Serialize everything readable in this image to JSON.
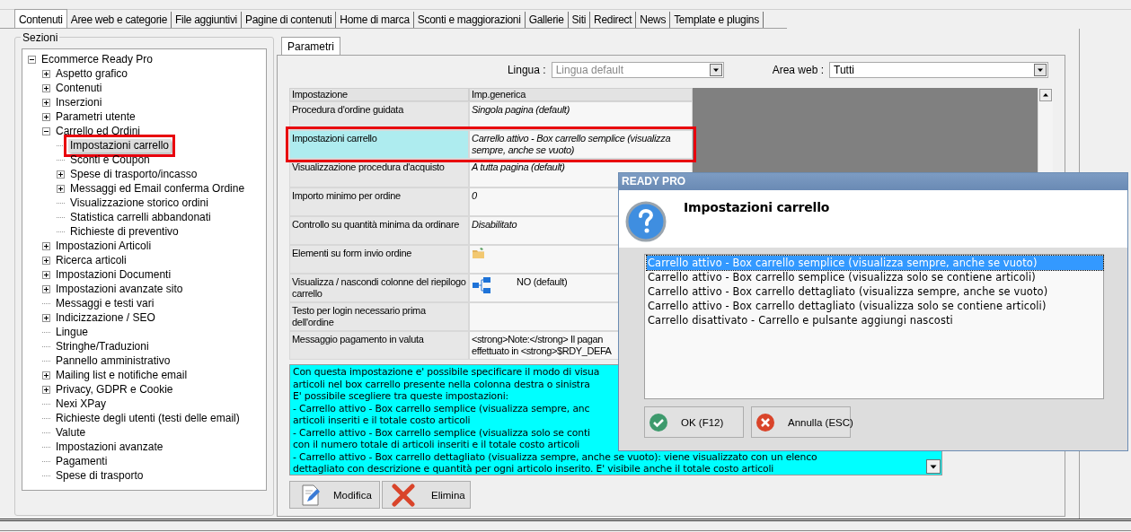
{
  "tabs": [
    {
      "label": "Contenuti",
      "selected": true
    },
    {
      "label": "Aree web e categorie",
      "selected": false
    },
    {
      "label": "File aggiuntivi",
      "selected": false
    },
    {
      "label": "Pagine di contenuti",
      "selected": false
    },
    {
      "label": "Home di marca",
      "selected": false
    },
    {
      "label": "Sconti e maggiorazioni",
      "selected": false
    },
    {
      "label": "Gallerie",
      "selected": false
    },
    {
      "label": "Siti",
      "selected": false
    },
    {
      "label": "Redirect",
      "selected": false
    },
    {
      "label": "News",
      "selected": false
    },
    {
      "label": "Template e plugins",
      "selected": false
    }
  ],
  "sections": {
    "title": "Sezioni",
    "tree": [
      {
        "label": "Ecommerce Ready Pro",
        "expanded": true,
        "selected": false,
        "highlighted": false,
        "children": [
          {
            "label": "Aspetto grafico",
            "expanded": false,
            "selected": false,
            "highlighted": false
          },
          {
            "label": "Contenuti",
            "expanded": false,
            "selected": false,
            "highlighted": false
          },
          {
            "label": "Inserzioni",
            "expanded": false,
            "selected": false,
            "highlighted": false
          },
          {
            "label": "Parametri utente",
            "expanded": false,
            "selected": false,
            "highlighted": false
          },
          {
            "label": "Carrello ed Ordini",
            "expanded": true,
            "selected": false,
            "highlighted": false,
            "children": [
              {
                "label": "Impostazioni carrello",
                "selected": true,
                "highlighted": true
              },
              {
                "label": "Sconti e Coupon",
                "selected": false,
                "highlighted": false
              },
              {
                "label": "Spese di trasporto/incasso",
                "expanded": false,
                "selected": false,
                "highlighted": false
              },
              {
                "label": "Messaggi ed Email conferma Ordine",
                "expanded": false,
                "selected": false,
                "highlighted": false
              },
              {
                "label": "Visualizzazione storico ordini",
                "selected": false,
                "highlighted": false
              },
              {
                "label": "Statistica carrelli abbandonati",
                "selected": false,
                "highlighted": false
              },
              {
                "label": "Richieste di preventivo",
                "selected": false,
                "highlighted": false
              }
            ]
          },
          {
            "label": "Impostazioni Articoli",
            "expanded": false,
            "selected": false,
            "highlighted": false
          },
          {
            "label": "Ricerca articoli",
            "expanded": false,
            "selected": false,
            "highlighted": false
          },
          {
            "label": "Impostazioni Documenti",
            "expanded": false,
            "selected": false,
            "highlighted": false
          },
          {
            "label": "Impostazioni avanzate sito",
            "expanded": false,
            "selected": false,
            "highlighted": false
          },
          {
            "label": "Messaggi e testi vari",
            "selected": false,
            "highlighted": false
          },
          {
            "label": "Indicizzazione / SEO",
            "expanded": false,
            "selected": false,
            "highlighted": false
          },
          {
            "label": "Lingue",
            "selected": false,
            "highlighted": false
          },
          {
            "label": "Stringhe/Traduzioni",
            "selected": false,
            "highlighted": false
          },
          {
            "label": "Pannello amministrativo",
            "selected": false,
            "highlighted": false
          },
          {
            "label": "Mailing list e notifiche email",
            "expanded": false,
            "selected": false,
            "highlighted": false
          },
          {
            "label": "Privacy, GDPR e Cookie",
            "expanded": false,
            "selected": false,
            "highlighted": false
          },
          {
            "label": "Nexi XPay",
            "selected": false,
            "highlighted": false
          },
          {
            "label": "Richieste degli utenti (testi delle email)",
            "selected": false,
            "highlighted": false
          },
          {
            "label": "Valute",
            "selected": false,
            "highlighted": false
          },
          {
            "label": "Impostazioni avanzate",
            "selected": false,
            "highlighted": false
          },
          {
            "label": "Pagamenti",
            "selected": false,
            "highlighted": false
          },
          {
            "label": "Spese di trasporto",
            "selected": false,
            "highlighted": false
          }
        ]
      }
    ]
  },
  "panel_tabs": [
    {
      "label": "Parametri",
      "selected": true
    }
  ],
  "filters": [
    {
      "label": "Lingua :",
      "value": "Lingua default",
      "disabled": true
    },
    {
      "label": "Area web :",
      "value": "Tutti",
      "disabled": false
    }
  ],
  "table": {
    "columns": [
      "Impostazione",
      "Imp.generica"
    ],
    "rows": [
      {
        "name": "Procedura d'ordine guidata",
        "kind": "text",
        "value": "Singola pagina (default)",
        "selected": false,
        "highlighted": false
      },
      {
        "name": "Impostazioni carrello",
        "kind": "text",
        "value": "Carrello attivo - Box carrello semplice (visualizza sempre, anche se vuoto)",
        "selected": true,
        "highlighted": true
      },
      {
        "name": "Visualizzazione procedura d'acquisto",
        "kind": "text",
        "value": "A tutta pagina (default)",
        "selected": false,
        "highlighted": false
      },
      {
        "name": "Importo minimo per ordine",
        "kind": "text",
        "value": "0",
        "selected": false,
        "highlighted": false
      },
      {
        "name": "Controllo su quantità minima da ordinare",
        "kind": "text",
        "value": "Disabilitato",
        "selected": false,
        "highlighted": false
      },
      {
        "name": "Elementi su form invio ordine",
        "kind": "folder",
        "selected": false,
        "highlighted": false
      },
      {
        "name": "Visualizza / nascondi colonne del riepilogo carrello",
        "kind": "columns",
        "value": "NO (default)",
        "selected": false,
        "highlighted": false
      },
      {
        "name": "Testo per login necessario prima dell'ordine",
        "kind": "empty",
        "selected": false,
        "highlighted": false
      },
      {
        "name": "Messaggio pagamento in valuta",
        "kind": "html",
        "value": "<strong>Note:</strong> Il pagan\neffettuato in <strong>$RDY_DEFA",
        "selected": false,
        "highlighted": false
      }
    ]
  },
  "description": [
    "Con questa impostazione e' possibile specificare il modo di visua",
    "articoli nel box carrello presente nella colonna destra o sinistra",
    "E' possibile scegliere tra queste impostazioni:",
    "- Carrello attivo - Box carrello semplice (visualizza sempre, anc",
    "articoli inseriti e il totale costo articoli",
    "- Carrello attivo - Box carrello semplice (visualizza solo se conti",
    "con il numero totale di articoli inseriti e il totale costo articoli",
    "- Carrello attivo - Box carrello dettagliato (visualizza sempre, anche se vuoto): viene visualizzato con un elenco",
    "dettagliato con descrizione e quantità per ogni articolo inserito. E' visibile anche il totale costo articoli"
  ],
  "buttons": [
    {
      "label": "Modifica",
      "kind": "edit"
    },
    {
      "label": "Elimina",
      "kind": "delete"
    }
  ],
  "dialog": {
    "title": "READY PRO",
    "heading": "Impostazioni carrello",
    "options": [
      {
        "label": "Carrello attivo - Box carrello semplice (visualizza sempre, anche se vuoto)",
        "selected": true
      },
      {
        "label": "Carrello attivo - Box carrello semplice (visualizza solo se contiene articoli)",
        "selected": false
      },
      {
        "label": "Carrello attivo - Box carrello dettagliato (visualizza sempre, anche se vuoto)",
        "selected": false
      },
      {
        "label": "Carrello attivo - Box carrello dettagliato (visualizza solo se contiene articoli)",
        "selected": false
      },
      {
        "label": "Carrello disattivato - Carrello e pulsante aggiungi nascosti",
        "selected": false
      }
    ],
    "buttons": [
      {
        "label": "OK (F12)",
        "kind": "ok"
      },
      {
        "label": "Annulla (ESC)",
        "kind": "cancel"
      }
    ]
  }
}
